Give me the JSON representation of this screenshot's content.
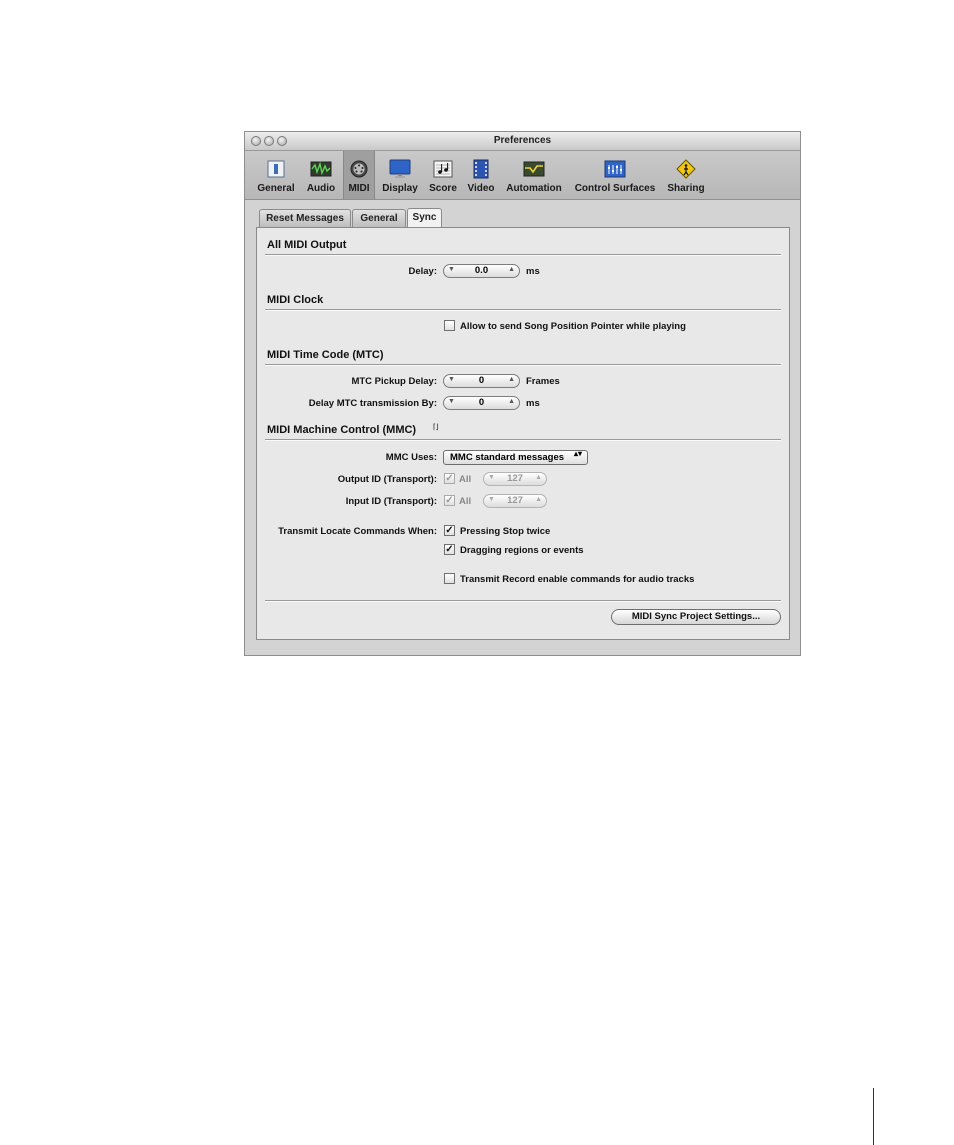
{
  "window": {
    "title": "Preferences"
  },
  "toolbar": {
    "items": [
      {
        "label": "General",
        "icon": "general-icon"
      },
      {
        "label": "Audio",
        "icon": "audio-icon"
      },
      {
        "label": "MIDI",
        "icon": "midi-icon",
        "selected": true
      },
      {
        "label": "Display",
        "icon": "display-icon"
      },
      {
        "label": "Score",
        "icon": "score-icon"
      },
      {
        "label": "Video",
        "icon": "video-icon"
      },
      {
        "label": "Automation",
        "icon": "automation-icon"
      },
      {
        "label": "Control Surfaces",
        "icon": "control-surfaces-icon"
      },
      {
        "label": "Sharing",
        "icon": "sharing-icon"
      }
    ]
  },
  "tabs": [
    {
      "label": "Reset Messages"
    },
    {
      "label": "General"
    },
    {
      "label": "Sync",
      "active": true
    }
  ],
  "all_midi_output": {
    "heading": "All MIDI Output",
    "delay_label": "Delay:",
    "delay_value": "0.0",
    "delay_unit": "ms"
  },
  "midi_clock": {
    "heading": "MIDI Clock",
    "spp_label": "Allow to send Song Position Pointer while playing",
    "spp_checked": false
  },
  "mtc": {
    "heading": "MIDI Time Code (MTC)",
    "pickup_label": "MTC Pickup Delay:",
    "pickup_value": "0",
    "pickup_unit": "Frames",
    "transmission_label": "Delay MTC transmission By:",
    "transmission_value": "0",
    "transmission_unit": "ms"
  },
  "mmc": {
    "heading": "MIDI Machine Control (MMC)",
    "heading_glyph": "⌈⌋",
    "uses_label": "MMC Uses:",
    "uses_value": "MMC standard messages",
    "uses_arrows": "▴▾",
    "output_label": "Output ID (Transport):",
    "output_all": "All",
    "output_value": "127",
    "input_label": "Input ID (Transport):",
    "input_all": "All",
    "input_value": "127",
    "locate_label": "Transmit Locate Commands When:",
    "pressing_stop": "Pressing Stop twice",
    "dragging": "Dragging regions or events",
    "record_enable": "Transmit Record enable commands for audio tracks"
  },
  "footer": {
    "project_settings_button": "MIDI Sync Project Settings..."
  },
  "glyphs": {
    "check": "✓",
    "down": "▼",
    "up": "▲"
  }
}
